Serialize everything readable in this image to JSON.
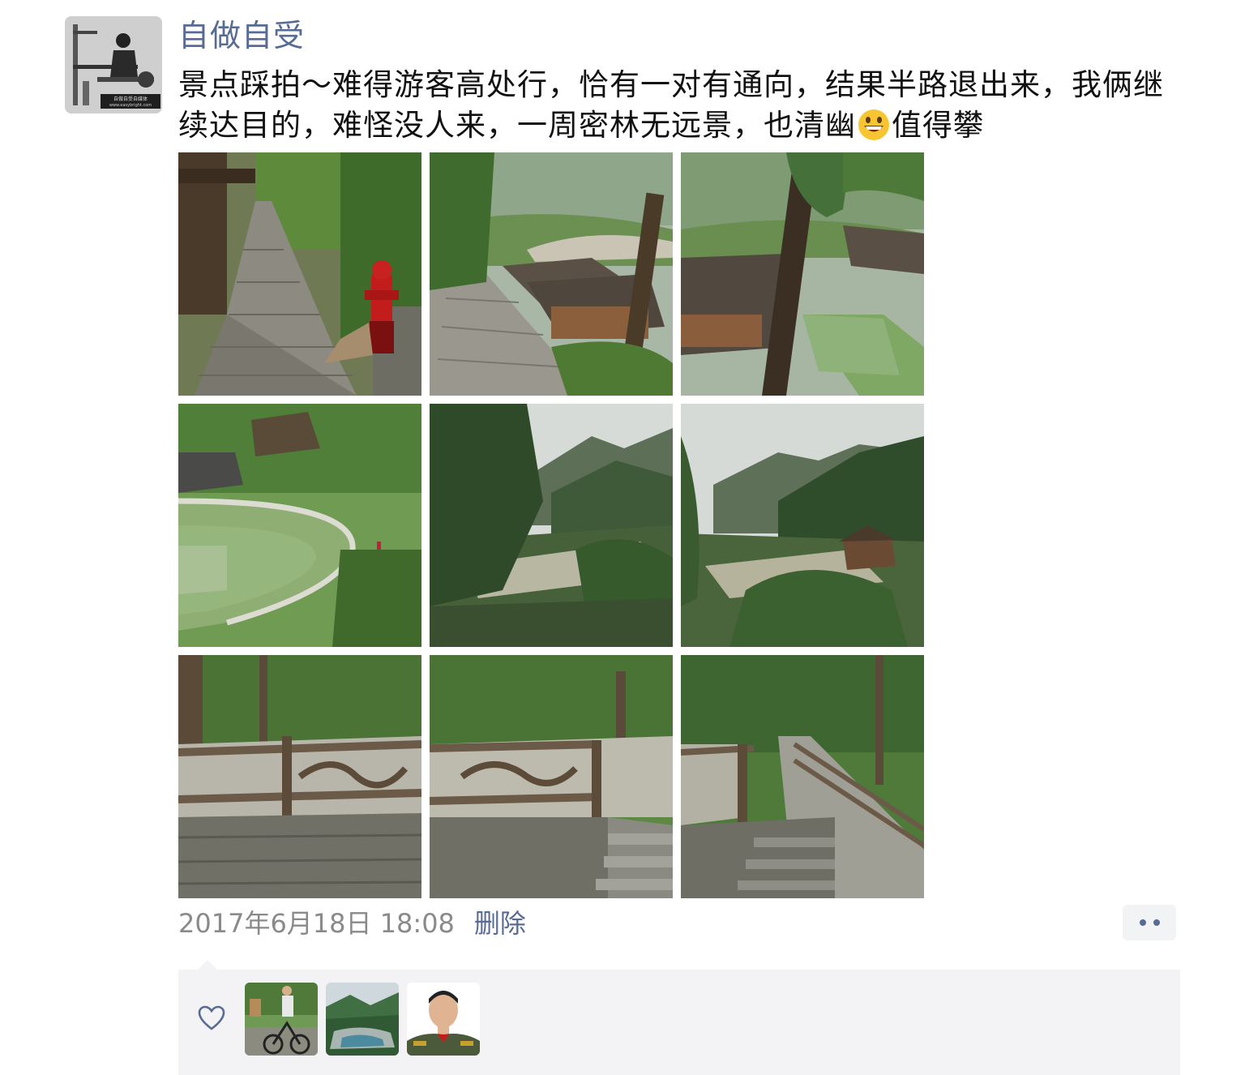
{
  "post": {
    "author": "自做自受",
    "text_part1": "景点踩拍～难得游客高处行，恰有一对有通向，结果半路退出来，我俩继续达目的，难怪没人来，一周密林无远景，也清幽",
    "text_emoji": "grinning-face-emoji",
    "text_part2": "值得攀",
    "timestamp": "2017年6月18日 18:08",
    "delete_label": "删除",
    "more_icon": "more-dots-icon",
    "avatar_caption": "自做自受自媒体",
    "avatar_url_text": "www.easybright.com"
  },
  "photos": [
    {
      "scene": "stone-path-hydrant"
    },
    {
      "scene": "village-overlook"
    },
    {
      "scene": "tree-village-rice"
    },
    {
      "scene": "terrace-curve"
    },
    {
      "scene": "mountain-valley"
    },
    {
      "scene": "mountain-village"
    },
    {
      "scene": "fence-forest"
    },
    {
      "scene": "fence-steps"
    },
    {
      "scene": "fence-path"
    }
  ],
  "likes": {
    "icon": "heart-outline-icon",
    "likers": [
      "cyclist-avatar",
      "river-valley-avatar",
      "officer-avatar"
    ]
  },
  "colors": {
    "link": "#576b95",
    "meta": "#8a8a8a",
    "likes_bg": "#f3f3f5"
  }
}
